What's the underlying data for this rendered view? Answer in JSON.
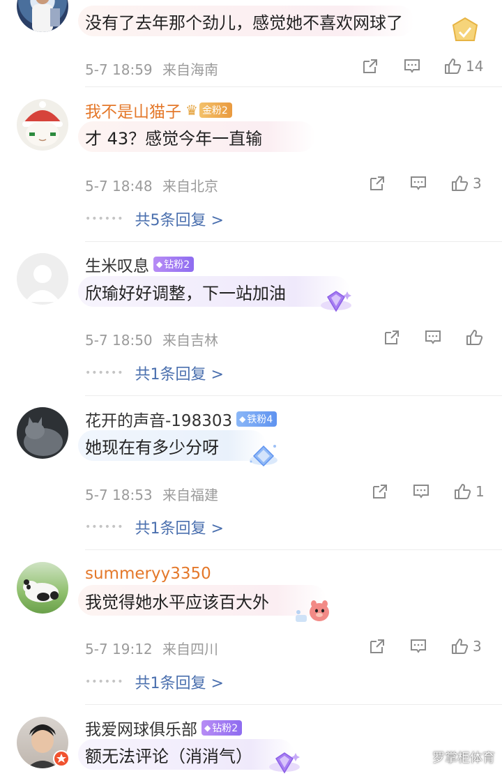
{
  "comments": [
    {
      "username": "",
      "text": "没有了去年那个劲儿，感觉她不喜欢网球了",
      "time": "5-7 18:59",
      "location": "来自海南",
      "likes": "14",
      "bubble": "pink"
    },
    {
      "username": "我不是山猫子",
      "badge": "金粉2",
      "badge_color": "#e99a3f",
      "text": "才 43？感觉今年一直输",
      "time": "5-7 18:48",
      "location": "来自北京",
      "likes": "3",
      "replies": "共5条回复 >",
      "bubble": "pink"
    },
    {
      "username": "生米叹息",
      "badge": "钻粉2",
      "badge_color": "#8e6cf0",
      "text": "欣瑜好好调整，下一站加油",
      "time": "5-7 18:50",
      "location": "来自吉林",
      "likes": "",
      "replies": "共1条回复 >",
      "bubble": "lavender"
    },
    {
      "username": "花开的声音-198303",
      "badge": "铁粉4",
      "badge_color": "#5f93f0",
      "text": "她现在有多少分呀",
      "time": "5-7 18:53",
      "location": "来自福建",
      "likes": "1",
      "replies": "共1条回复 >",
      "bubble": "sky"
    },
    {
      "username": "summeryy3350",
      "text": "我觉得她水平应该百大外",
      "time": "5-7 19:12",
      "location": "来自四川",
      "likes": "3",
      "replies": "共1条回复 >",
      "bubble": "pink"
    },
    {
      "username": "我爱网球俱乐部",
      "badge": "钻粉2",
      "badge_color": "#8e6cf0",
      "text": "额无法评论（消消气）",
      "bubble": "lavender"
    }
  ],
  "watermark": "罗掌柜体育",
  "icons": [
    "share-icon",
    "comment-icon",
    "like-icon"
  ],
  "colors": {
    "vip_username": "#e4782a",
    "reply_link": "#4a6fae",
    "meta_text": "#9b9b9b"
  }
}
